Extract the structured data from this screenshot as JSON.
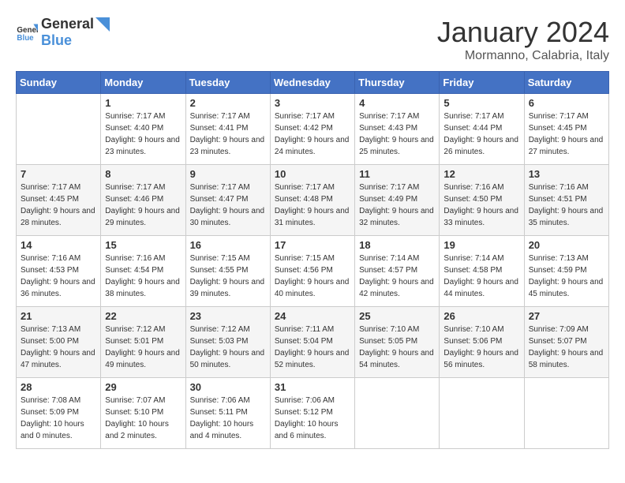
{
  "logo": {
    "general": "General",
    "blue": "Blue"
  },
  "title": "January 2024",
  "subtitle": "Mormanno, Calabria, Italy",
  "headers": [
    "Sunday",
    "Monday",
    "Tuesday",
    "Wednesday",
    "Thursday",
    "Friday",
    "Saturday"
  ],
  "weeks": [
    [
      {
        "day": "",
        "sunrise": "",
        "sunset": "",
        "daylight": ""
      },
      {
        "day": "1",
        "sunrise": "Sunrise: 7:17 AM",
        "sunset": "Sunset: 4:40 PM",
        "daylight": "Daylight: 9 hours and 23 minutes."
      },
      {
        "day": "2",
        "sunrise": "Sunrise: 7:17 AM",
        "sunset": "Sunset: 4:41 PM",
        "daylight": "Daylight: 9 hours and 23 minutes."
      },
      {
        "day": "3",
        "sunrise": "Sunrise: 7:17 AM",
        "sunset": "Sunset: 4:42 PM",
        "daylight": "Daylight: 9 hours and 24 minutes."
      },
      {
        "day": "4",
        "sunrise": "Sunrise: 7:17 AM",
        "sunset": "Sunset: 4:43 PM",
        "daylight": "Daylight: 9 hours and 25 minutes."
      },
      {
        "day": "5",
        "sunrise": "Sunrise: 7:17 AM",
        "sunset": "Sunset: 4:44 PM",
        "daylight": "Daylight: 9 hours and 26 minutes."
      },
      {
        "day": "6",
        "sunrise": "Sunrise: 7:17 AM",
        "sunset": "Sunset: 4:45 PM",
        "daylight": "Daylight: 9 hours and 27 minutes."
      }
    ],
    [
      {
        "day": "7",
        "sunrise": "Sunrise: 7:17 AM",
        "sunset": "Sunset: 4:45 PM",
        "daylight": "Daylight: 9 hours and 28 minutes."
      },
      {
        "day": "8",
        "sunrise": "Sunrise: 7:17 AM",
        "sunset": "Sunset: 4:46 PM",
        "daylight": "Daylight: 9 hours and 29 minutes."
      },
      {
        "day": "9",
        "sunrise": "Sunrise: 7:17 AM",
        "sunset": "Sunset: 4:47 PM",
        "daylight": "Daylight: 9 hours and 30 minutes."
      },
      {
        "day": "10",
        "sunrise": "Sunrise: 7:17 AM",
        "sunset": "Sunset: 4:48 PM",
        "daylight": "Daylight: 9 hours and 31 minutes."
      },
      {
        "day": "11",
        "sunrise": "Sunrise: 7:17 AM",
        "sunset": "Sunset: 4:49 PM",
        "daylight": "Daylight: 9 hours and 32 minutes."
      },
      {
        "day": "12",
        "sunrise": "Sunrise: 7:16 AM",
        "sunset": "Sunset: 4:50 PM",
        "daylight": "Daylight: 9 hours and 33 minutes."
      },
      {
        "day": "13",
        "sunrise": "Sunrise: 7:16 AM",
        "sunset": "Sunset: 4:51 PM",
        "daylight": "Daylight: 9 hours and 35 minutes."
      }
    ],
    [
      {
        "day": "14",
        "sunrise": "Sunrise: 7:16 AM",
        "sunset": "Sunset: 4:53 PM",
        "daylight": "Daylight: 9 hours and 36 minutes."
      },
      {
        "day": "15",
        "sunrise": "Sunrise: 7:16 AM",
        "sunset": "Sunset: 4:54 PM",
        "daylight": "Daylight: 9 hours and 38 minutes."
      },
      {
        "day": "16",
        "sunrise": "Sunrise: 7:15 AM",
        "sunset": "Sunset: 4:55 PM",
        "daylight": "Daylight: 9 hours and 39 minutes."
      },
      {
        "day": "17",
        "sunrise": "Sunrise: 7:15 AM",
        "sunset": "Sunset: 4:56 PM",
        "daylight": "Daylight: 9 hours and 40 minutes."
      },
      {
        "day": "18",
        "sunrise": "Sunrise: 7:14 AM",
        "sunset": "Sunset: 4:57 PM",
        "daylight": "Daylight: 9 hours and 42 minutes."
      },
      {
        "day": "19",
        "sunrise": "Sunrise: 7:14 AM",
        "sunset": "Sunset: 4:58 PM",
        "daylight": "Daylight: 9 hours and 44 minutes."
      },
      {
        "day": "20",
        "sunrise": "Sunrise: 7:13 AM",
        "sunset": "Sunset: 4:59 PM",
        "daylight": "Daylight: 9 hours and 45 minutes."
      }
    ],
    [
      {
        "day": "21",
        "sunrise": "Sunrise: 7:13 AM",
        "sunset": "Sunset: 5:00 PM",
        "daylight": "Daylight: 9 hours and 47 minutes."
      },
      {
        "day": "22",
        "sunrise": "Sunrise: 7:12 AM",
        "sunset": "Sunset: 5:01 PM",
        "daylight": "Daylight: 9 hours and 49 minutes."
      },
      {
        "day": "23",
        "sunrise": "Sunrise: 7:12 AM",
        "sunset": "Sunset: 5:03 PM",
        "daylight": "Daylight: 9 hours and 50 minutes."
      },
      {
        "day": "24",
        "sunrise": "Sunrise: 7:11 AM",
        "sunset": "Sunset: 5:04 PM",
        "daylight": "Daylight: 9 hours and 52 minutes."
      },
      {
        "day": "25",
        "sunrise": "Sunrise: 7:10 AM",
        "sunset": "Sunset: 5:05 PM",
        "daylight": "Daylight: 9 hours and 54 minutes."
      },
      {
        "day": "26",
        "sunrise": "Sunrise: 7:10 AM",
        "sunset": "Sunset: 5:06 PM",
        "daylight": "Daylight: 9 hours and 56 minutes."
      },
      {
        "day": "27",
        "sunrise": "Sunrise: 7:09 AM",
        "sunset": "Sunset: 5:07 PM",
        "daylight": "Daylight: 9 hours and 58 minutes."
      }
    ],
    [
      {
        "day": "28",
        "sunrise": "Sunrise: 7:08 AM",
        "sunset": "Sunset: 5:09 PM",
        "daylight": "Daylight: 10 hours and 0 minutes."
      },
      {
        "day": "29",
        "sunrise": "Sunrise: 7:07 AM",
        "sunset": "Sunset: 5:10 PM",
        "daylight": "Daylight: 10 hours and 2 minutes."
      },
      {
        "day": "30",
        "sunrise": "Sunrise: 7:06 AM",
        "sunset": "Sunset: 5:11 PM",
        "daylight": "Daylight: 10 hours and 4 minutes."
      },
      {
        "day": "31",
        "sunrise": "Sunrise: 7:06 AM",
        "sunset": "Sunset: 5:12 PM",
        "daylight": "Daylight: 10 hours and 6 minutes."
      },
      {
        "day": "",
        "sunrise": "",
        "sunset": "",
        "daylight": ""
      },
      {
        "day": "",
        "sunrise": "",
        "sunset": "",
        "daylight": ""
      },
      {
        "day": "",
        "sunrise": "",
        "sunset": "",
        "daylight": ""
      }
    ]
  ]
}
